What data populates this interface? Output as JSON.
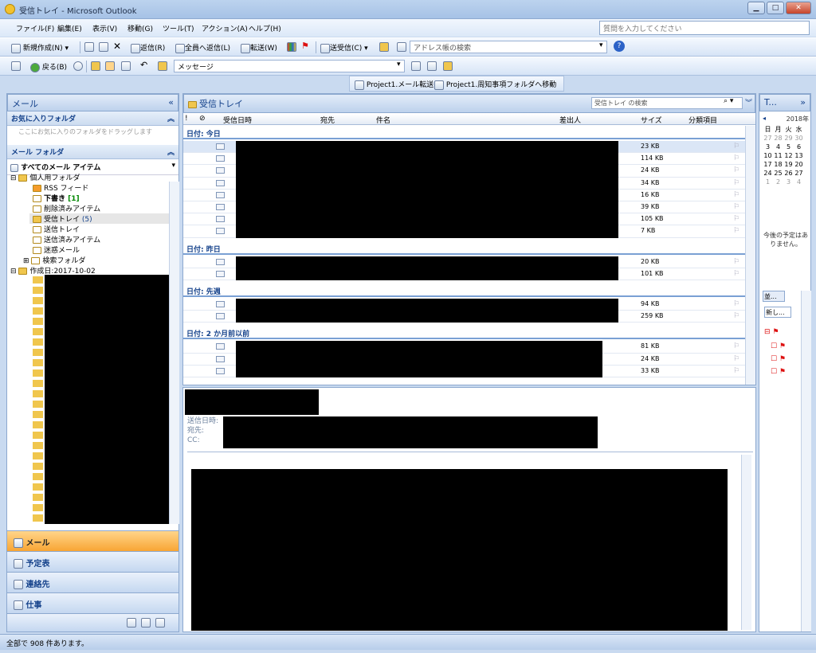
{
  "window": {
    "title": "受信トレイ - Microsoft Outlook"
  },
  "menu": [
    "ファイル(F)",
    "編集(E)",
    "表示(V)",
    "移動(G)",
    "ツール(T)",
    "アクション(A)",
    "ヘルプ(H)"
  ],
  "help_placeholder": "質問を入力してください",
  "toolbar1": {
    "new": "新規作成(N)",
    "reply": "返信(R)",
    "reply_all": "全員へ返信(L)",
    "forward": "転送(W)",
    "send_receive": "送受信(C)",
    "address_search": "アドレス帳の検索"
  },
  "toolbar2": {
    "back": "戻る(B)",
    "message": "メッセージ"
  },
  "toolbar3": {
    "macro1": "Project1.メール転送",
    "macro2": "Project1.周知事項フォルダへ移動"
  },
  "nav": {
    "title": "メール",
    "fav_header": "お気に入りフォルダ",
    "fav_hint": "ここにお気に入りのフォルダをドラッグします",
    "mail_folders_header": "メール フォルダ",
    "all_items": "すべてのメール アイテム",
    "tree": {
      "personal": "個人用フォルダ",
      "rss": "RSS フィード",
      "drafts": "下書き",
      "drafts_count": "[1]",
      "deleted": "削除済みアイテム",
      "inbox": "受信トレイ",
      "inbox_count": "(5)",
      "outbox": "送信トレイ",
      "sent": "送信済みアイテム",
      "junk": "迷惑メール",
      "search": "検索フォルダ",
      "archive": "作成日:2017-10-02"
    },
    "buttons": [
      "メール",
      "予定表",
      "連絡先",
      "仕事"
    ]
  },
  "list": {
    "title": "受信トレイ",
    "search_placeholder": "受信トレイ の検索",
    "columns": {
      "received": "受信日時",
      "to": "宛先",
      "subject": "件名",
      "from": "差出人",
      "size": "サイズ",
      "category": "分類項目"
    },
    "groups": [
      {
        "label": "日付: 今日",
        "rows": [
          "23 KB",
          "114 KB",
          "24 KB",
          "34 KB",
          "16 KB",
          "39 KB",
          "105 KB",
          "7 KB"
        ]
      },
      {
        "label": "日付: 昨日",
        "rows": [
          "20 KB",
          "101 KB"
        ]
      },
      {
        "label": "日付: 先週",
        "rows": [
          "94 KB",
          "259 KB"
        ]
      },
      {
        "label": "日付: 2 か月前以前",
        "rows": [
          "81 KB",
          "24 KB",
          "33 KB"
        ]
      }
    ]
  },
  "reading": {
    "sent_label": "送信日時:",
    "to_label": "宛先:",
    "cc_label": "CC:"
  },
  "todo": {
    "title": "T...",
    "year": "2018年",
    "weekdays": [
      "日",
      "月",
      "火",
      "水"
    ],
    "weeks": [
      [
        "27",
        "28",
        "29",
        "30"
      ],
      [
        "3",
        "4",
        "5",
        "6"
      ],
      [
        "10",
        "11",
        "12",
        "13"
      ],
      [
        "17",
        "18",
        "19",
        "20"
      ],
      [
        "24",
        "25",
        "26",
        "27"
      ],
      [
        "1",
        "2",
        "3",
        "4"
      ]
    ],
    "no_appointments": "今後の予定はありません。",
    "sort_label": "並...",
    "new_task": "新し..."
  },
  "status": "全部で 908 件あります。"
}
